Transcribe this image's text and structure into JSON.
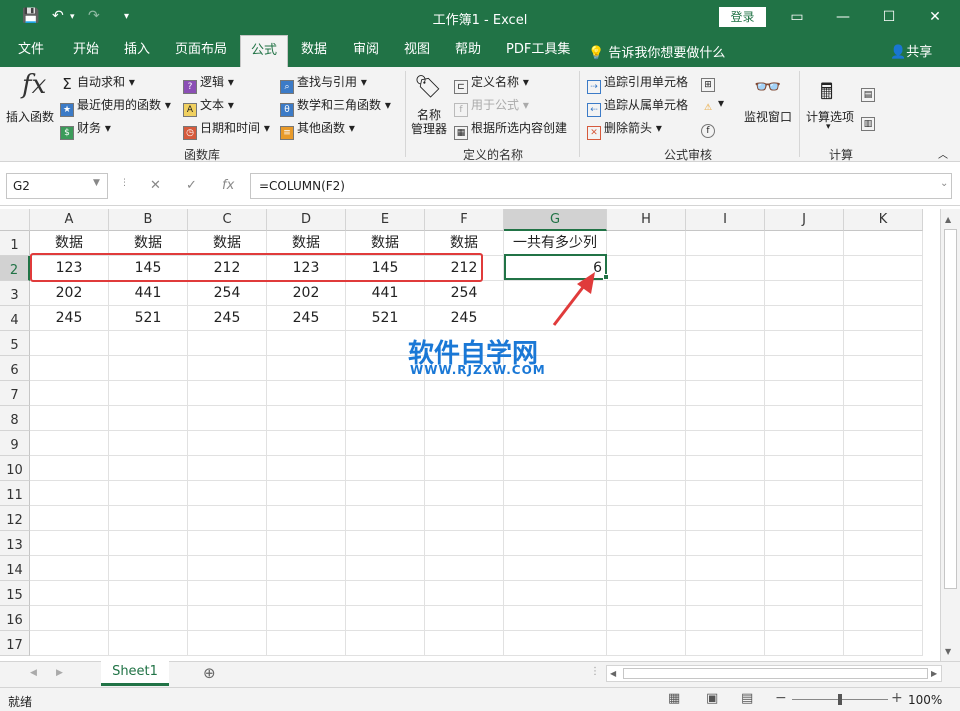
{
  "app": {
    "title": "工作簿1  -  Excel",
    "login": "登录"
  },
  "tabs": [
    "文件",
    "开始",
    "插入",
    "页面布局",
    "公式",
    "数据",
    "审阅",
    "视图",
    "帮助",
    "PDF工具集"
  ],
  "tellme": "告诉我你想要做什么",
  "share": "共享",
  "ribbon": {
    "insert_function": "插入函数",
    "autosum": "自动求和",
    "recent": "最近使用的函数",
    "finance": "财务",
    "logic": "逻辑",
    "text": "文本",
    "datetime": "日期和时间",
    "lookup": "查找与引用",
    "math": "数学和三角函数",
    "more": "其他函数",
    "group_lib": "函数库",
    "name_manager": "名称\n管理器",
    "define_name": "定义名称",
    "use_in_formula": "用于公式",
    "create_from_sel": "根据所选内容创建",
    "group_names": "定义的名称",
    "trace_prec": "追踪引用单元格",
    "trace_dep": "追踪从属单元格",
    "remove_arrows": "删除箭头",
    "group_audit": "公式审核",
    "watch": "监视窗口",
    "calc_options": "计算选项",
    "group_calc": "计算"
  },
  "namebox": "G2",
  "formula": "=COLUMN(F2)",
  "columns": [
    "A",
    "B",
    "C",
    "D",
    "E",
    "F",
    "G",
    "H",
    "I",
    "J",
    "K"
  ],
  "rows": [
    "1",
    "2",
    "3",
    "4",
    "5",
    "6",
    "7",
    "8",
    "9",
    "10",
    "11",
    "12",
    "13",
    "14",
    "15",
    "16",
    "17"
  ],
  "cells": [
    [
      "数据",
      "数据",
      "数据",
      "数据",
      "数据",
      "数据",
      "一共有多少列"
    ],
    [
      "123",
      "145",
      "212",
      "123",
      "145",
      "212",
      "6"
    ],
    [
      "202",
      "441",
      "254",
      "202",
      "441",
      "254",
      ""
    ],
    [
      "245",
      "521",
      "245",
      "245",
      "521",
      "245",
      ""
    ]
  ],
  "watermark": {
    "main": "软件自学网",
    "url": "WWW.RJZXW.COM"
  },
  "sheet": "Sheet1",
  "status": {
    "ready": "就绪",
    "zoom": "100%"
  },
  "colors": {
    "excel_green": "#217346",
    "highlight_red": "#e03b3b",
    "watermark_blue": "#1a78d6"
  }
}
